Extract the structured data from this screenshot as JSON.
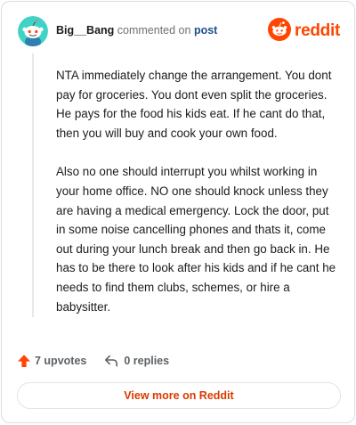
{
  "colors": {
    "brand": "#ff4500",
    "link": "#1e4e8c",
    "upvote": "#ff4500",
    "view_more_text": "#d93a00"
  },
  "header": {
    "author": "Big__Bang",
    "commented_text": "commented on",
    "post_link": "post",
    "avatar_icon": "reddit-snoo-avatar-icon",
    "logo_icon": "reddit-logo-icon",
    "logo_text": "reddit"
  },
  "comment": {
    "paragraphs": [
      "NTA immediately change the arrangement. You dont pay for groceries. You dont even split the groceries. He pays for the food his kids eat. If he cant do that, then you will buy and cook your own food.",
      "Also no one should interrupt you whilst working in your home office. NO one should knock unless they are having a medical emergency. Lock the door, put in some noise cancelling phones and thats it, come out during your lunch break and then go back in. He has to be there to look after his kids and if he cant he needs to find them clubs, schemes, or hire a babysitter."
    ]
  },
  "actions": {
    "upvotes_label": "7 upvotes",
    "upvote_icon": "upvote-arrow-icon",
    "replies_label": "0 replies",
    "reply_icon": "reply-arrow-icon"
  },
  "footer": {
    "view_more_label": "View more on Reddit"
  }
}
